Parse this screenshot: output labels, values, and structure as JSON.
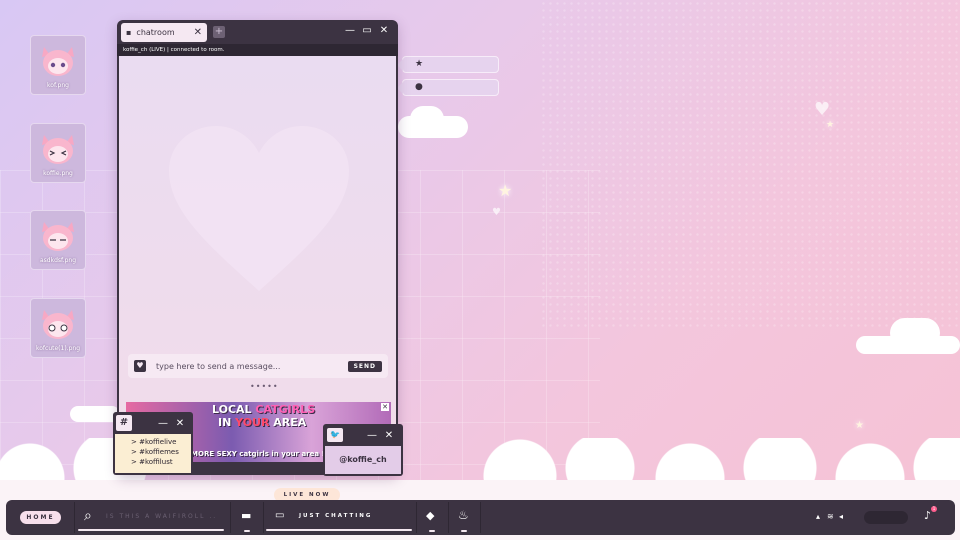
{
  "desktop": {
    "icons": [
      {
        "label": "kof.png",
        "icon": "catgirl-image-icon"
      },
      {
        "label": "koffie.png",
        "icon": "catgirl-image-icon"
      },
      {
        "label": "asdkdsf.png",
        "icon": "catgirl-image-icon"
      },
      {
        "label": "kofcute(1).png",
        "icon": "catgirl-image-icon"
      }
    ]
  },
  "chat_window": {
    "tab_label": "chatroom",
    "status_text": "koffie_ch (LIVE)  |  connected to room.",
    "message_placeholder": "type here to send a message...",
    "send_label": "SEND",
    "drag_handle": "•••••"
  },
  "ad": {
    "line1_a": "LOCAL ",
    "line1_b": "CATGIRLS",
    "line2_a": "IN ",
    "line2_b": "YOUR",
    "line2_c": " AREA",
    "line3": "I MORE SEXY catgirls in your area !"
  },
  "hashtag_window": {
    "icon_glyph": "#",
    "items": [
      "> #koffielive",
      "> #koffiemes",
      "> #koffilust"
    ]
  },
  "twitter_window": {
    "handle": "@koffie_ch"
  },
  "taskbar": {
    "home_label": "HOME",
    "search_placeholder": "IS THIS A WAIFIROLL ...T",
    "category_label": "JUST CHATTING",
    "live_badge": "LIVE NOW",
    "notification_count": "1"
  },
  "colors": {
    "window_dark": "#3c3342",
    "accent_pink": "#f6c2d4",
    "accent_lavender": "#d8c8f4"
  }
}
